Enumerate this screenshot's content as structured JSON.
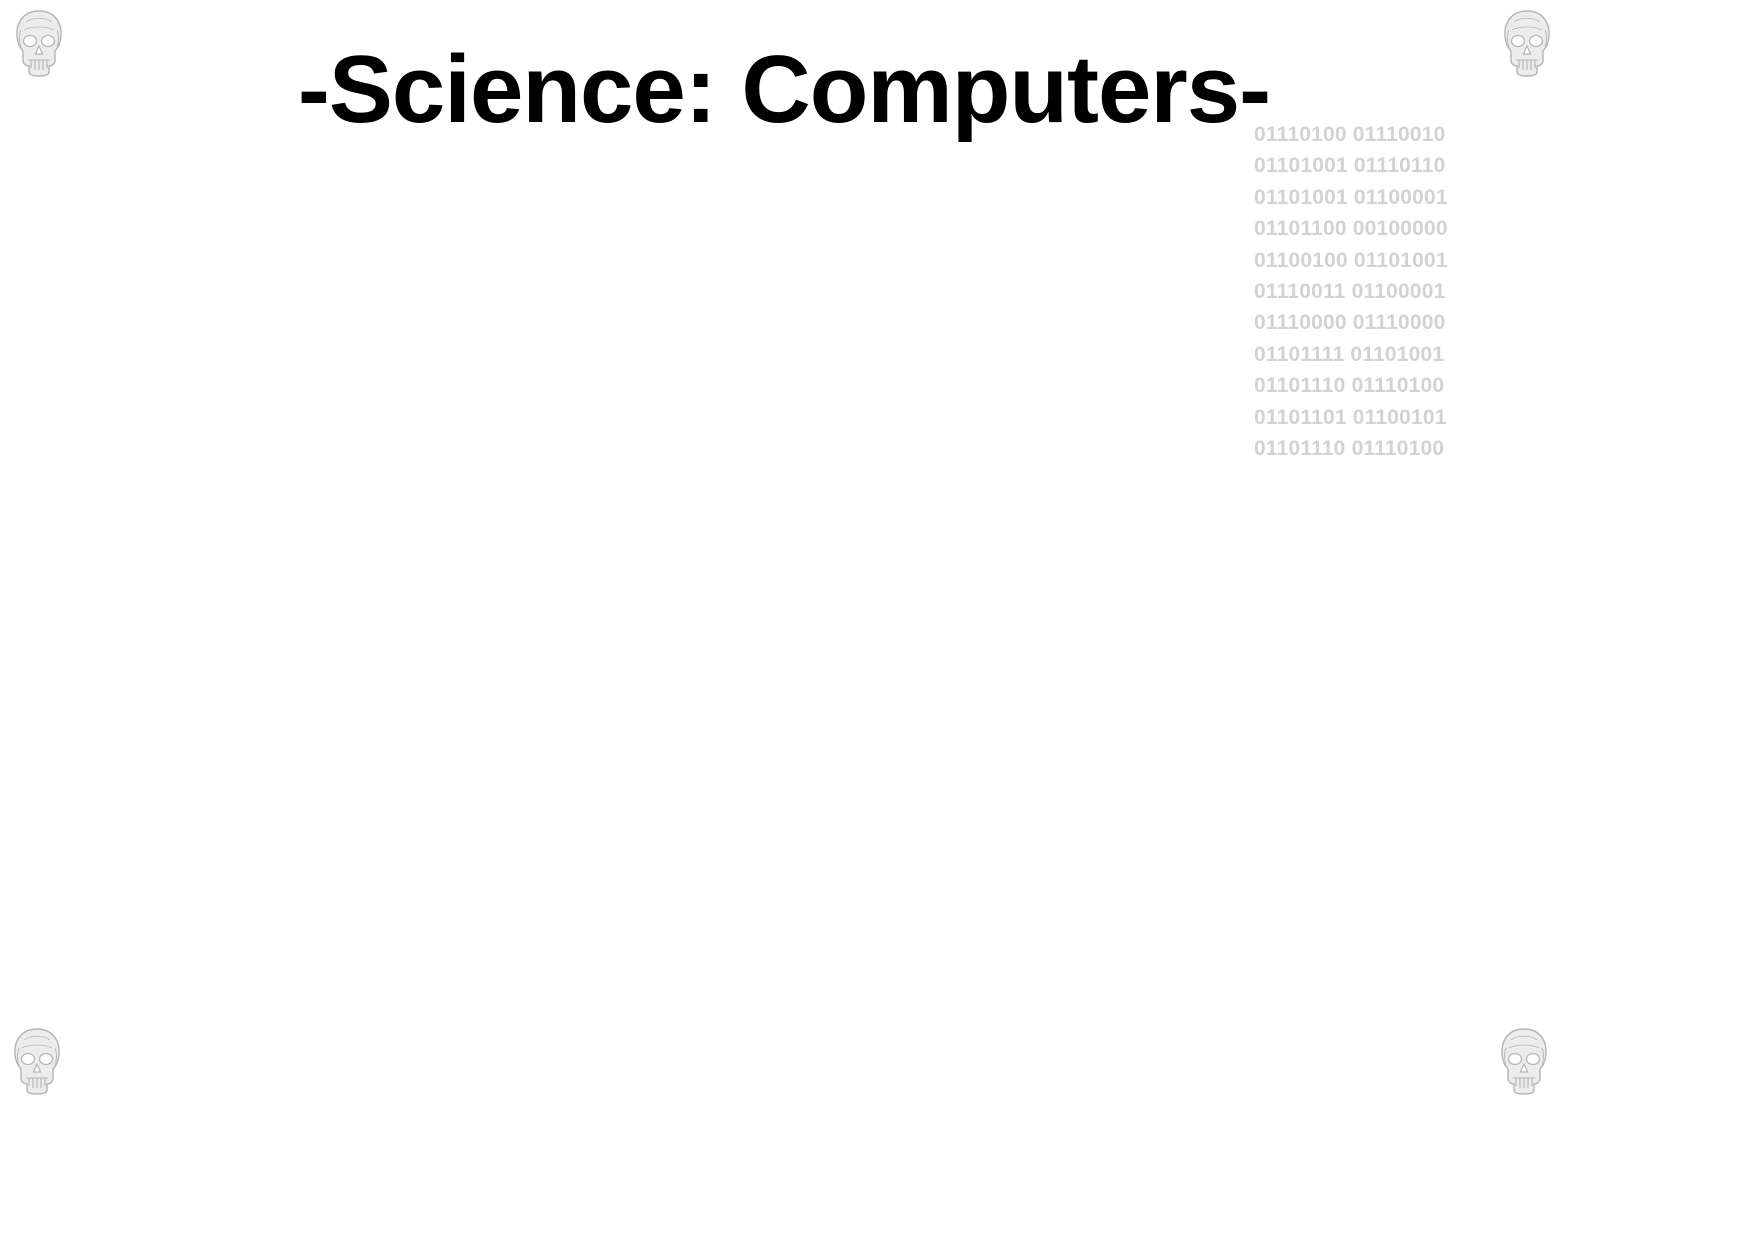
{
  "title": "-Science: Computers-",
  "binary_lines": [
    "01110100 01110010",
    "01101001 01110110",
    "01101001 01100001",
    "01101100 00100000",
    "01100100 01101001",
    "01110011 01100001",
    "01110000 01110000",
    "01101111 01101001",
    "01101110 01110100",
    "01101101 01100101",
    "01101110 01110100"
  ],
  "colors": {
    "title": "#000000",
    "binary_text": "#d2d2d2",
    "skull_fill": "#ececec",
    "skull_stroke": "#b4b4b4"
  },
  "icons": {
    "corner_decoration": "skull-icon"
  }
}
